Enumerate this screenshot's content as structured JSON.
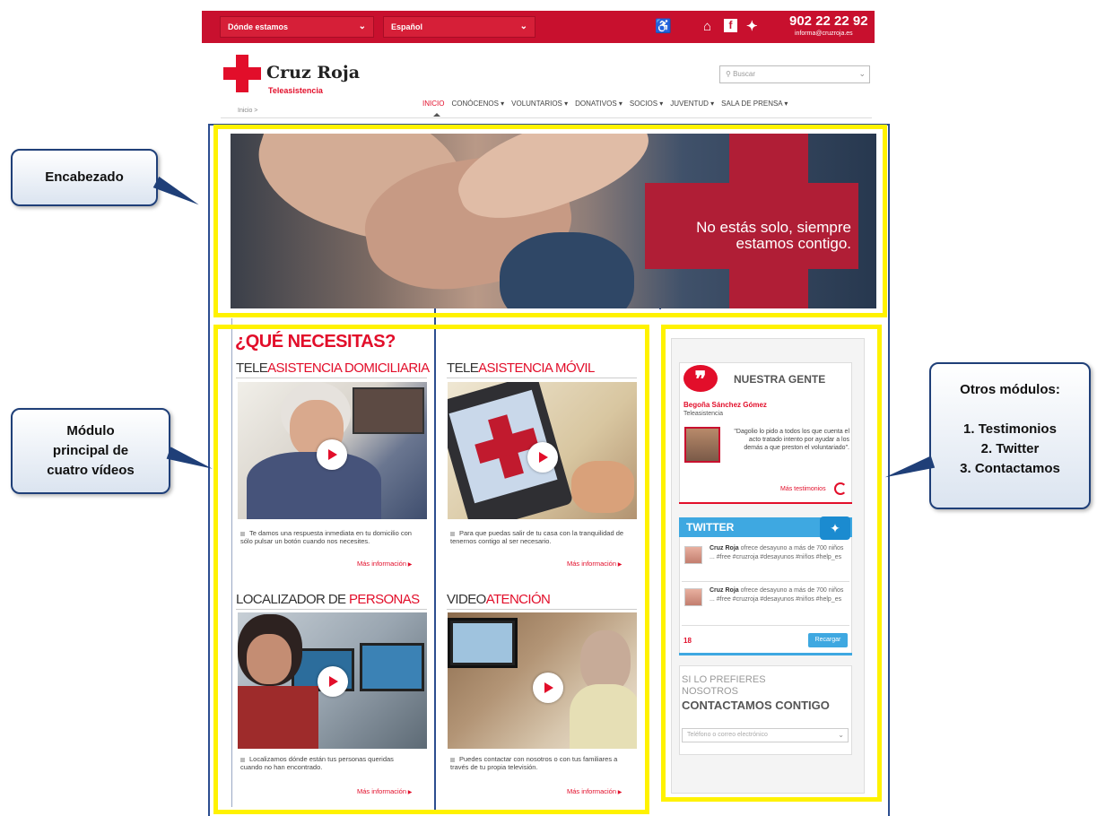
{
  "topbar": {
    "location_select": "Dónde estamos",
    "language_select": "Español",
    "phone": "902 22 22 92",
    "email": "informa@cruzroja.es",
    "icons": [
      "accessibility-icon",
      "google-plus-icon",
      "facebook-icon",
      "twitter-icon"
    ]
  },
  "header": {
    "logo_title": "Cruz Roja",
    "logo_subtitle": "Teleasistencia",
    "breadcrumb": "Inicio >",
    "search_placeholder": "Buscar",
    "nav": [
      "INICIO",
      "CONÓCENOS ▾",
      "VOLUNTARIOS ▾",
      "DONATIVOS ▾",
      "SOCIOS ▾",
      "JUVENTUD ▾",
      "SALA DE PRENSA ▾"
    ]
  },
  "banner": {
    "text_line1": "No estás solo, siempre",
    "text_line2": "estamos contigo."
  },
  "videos": {
    "module_title": "¿QUÉ NECESITAS?",
    "more_label": "Más información",
    "items": [
      {
        "title_a": "TELE",
        "title_b": "ASISTENCIA DOMICILIARIA",
        "desc": "Te damos una respuesta inmediata en tu domicilio con sólo pulsar un botón cuando nos necesites."
      },
      {
        "title_a": "TELE",
        "title_b": "ASISTENCIA MÓVIL",
        "desc": "Para que puedas salir de tu casa con la tranquilidad de tenernos contigo al ser necesario."
      },
      {
        "title_a": "LOCALIZADOR DE ",
        "title_b": "PERSONAS",
        "desc": "Localizamos dónde están tus personas queridas cuando no han encontrado."
      },
      {
        "title_a": "VIDEO",
        "title_b": "ATENCIÓN",
        "desc": "Puedes contactar con nosotros o con tus familiares a través de tu propia televisión."
      }
    ]
  },
  "sidebar": {
    "testimonials": {
      "title": "NUESTRA GENTE",
      "name": "Begoña Sánchez Gómez",
      "role": "Teleasistencia",
      "quote": "\"Dagolio lo pido a todos los que cuenta el acto tratado intento por ayudar a los demás a que preston el voluntariado\".",
      "more": "Más testimonios"
    },
    "twitter": {
      "title": "TWITTER",
      "tweets": [
        {
          "author": "Cruz Roja",
          "text": "ofrece desayuno a más de 700 niños ... #free #cruzroja #desayunos #niños #help_es"
        },
        {
          "author": "Cruz Roja",
          "text": "ofrece desayuno a más de 700 niños ... #free #cruzroja #desayunos #niños #help_es"
        }
      ],
      "count": "18",
      "reload": "Recargar"
    },
    "contact": {
      "line1": "SI LO PREFIERES",
      "line2": "NOSOTROS",
      "line3": "CONTACTAMOS CONTIGO",
      "input_placeholder": "Teléfono o correo electrónico"
    }
  },
  "callouts": {
    "header": "Encabezado",
    "videos_l1": "Módulo",
    "videos_l2": "principal de",
    "videos_l3": "cuatro vídeos",
    "others_title": "Otros módulos:",
    "others_1": "1. Testimonios",
    "others_2": "2. Twitter",
    "others_3": "3. Contactamos"
  },
  "colors": {
    "brand_red": "#e20e2a",
    "topbar_red": "#c8102e",
    "highlight_yellow": "#fff200",
    "frame_blue": "#2c4d8f",
    "twitter_blue": "#3ea8e1"
  }
}
